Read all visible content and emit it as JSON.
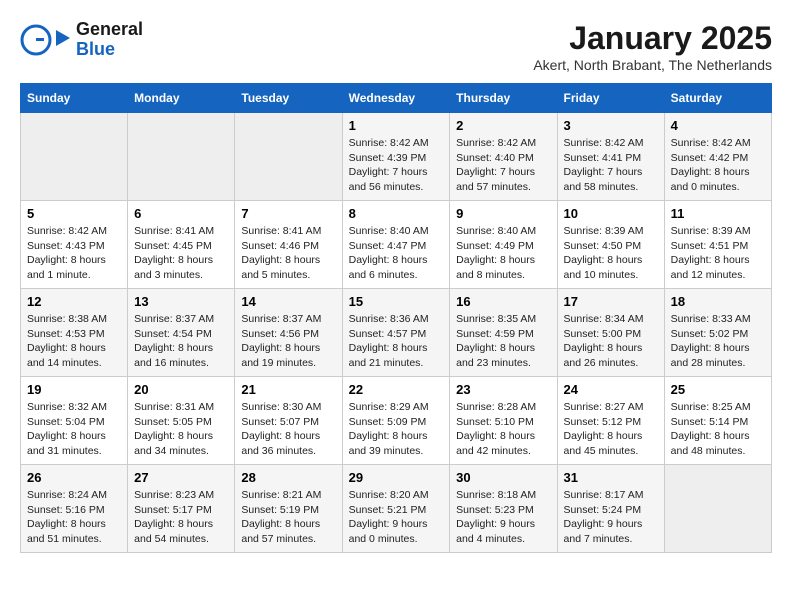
{
  "header": {
    "logo_line1": "General",
    "logo_line2": "Blue",
    "title": "January 2025",
    "subtitle": "Akert, North Brabant, The Netherlands"
  },
  "weekdays": [
    "Sunday",
    "Monday",
    "Tuesday",
    "Wednesday",
    "Thursday",
    "Friday",
    "Saturday"
  ],
  "weeks": [
    [
      {
        "day": "",
        "info": ""
      },
      {
        "day": "",
        "info": ""
      },
      {
        "day": "",
        "info": ""
      },
      {
        "day": "1",
        "info": "Sunrise: 8:42 AM\nSunset: 4:39 PM\nDaylight: 7 hours and 56 minutes."
      },
      {
        "day": "2",
        "info": "Sunrise: 8:42 AM\nSunset: 4:40 PM\nDaylight: 7 hours and 57 minutes."
      },
      {
        "day": "3",
        "info": "Sunrise: 8:42 AM\nSunset: 4:41 PM\nDaylight: 7 hours and 58 minutes."
      },
      {
        "day": "4",
        "info": "Sunrise: 8:42 AM\nSunset: 4:42 PM\nDaylight: 8 hours and 0 minutes."
      }
    ],
    [
      {
        "day": "5",
        "info": "Sunrise: 8:42 AM\nSunset: 4:43 PM\nDaylight: 8 hours and 1 minute."
      },
      {
        "day": "6",
        "info": "Sunrise: 8:41 AM\nSunset: 4:45 PM\nDaylight: 8 hours and 3 minutes."
      },
      {
        "day": "7",
        "info": "Sunrise: 8:41 AM\nSunset: 4:46 PM\nDaylight: 8 hours and 5 minutes."
      },
      {
        "day": "8",
        "info": "Sunrise: 8:40 AM\nSunset: 4:47 PM\nDaylight: 8 hours and 6 minutes."
      },
      {
        "day": "9",
        "info": "Sunrise: 8:40 AM\nSunset: 4:49 PM\nDaylight: 8 hours and 8 minutes."
      },
      {
        "day": "10",
        "info": "Sunrise: 8:39 AM\nSunset: 4:50 PM\nDaylight: 8 hours and 10 minutes."
      },
      {
        "day": "11",
        "info": "Sunrise: 8:39 AM\nSunset: 4:51 PM\nDaylight: 8 hours and 12 minutes."
      }
    ],
    [
      {
        "day": "12",
        "info": "Sunrise: 8:38 AM\nSunset: 4:53 PM\nDaylight: 8 hours and 14 minutes."
      },
      {
        "day": "13",
        "info": "Sunrise: 8:37 AM\nSunset: 4:54 PM\nDaylight: 8 hours and 16 minutes."
      },
      {
        "day": "14",
        "info": "Sunrise: 8:37 AM\nSunset: 4:56 PM\nDaylight: 8 hours and 19 minutes."
      },
      {
        "day": "15",
        "info": "Sunrise: 8:36 AM\nSunset: 4:57 PM\nDaylight: 8 hours and 21 minutes."
      },
      {
        "day": "16",
        "info": "Sunrise: 8:35 AM\nSunset: 4:59 PM\nDaylight: 8 hours and 23 minutes."
      },
      {
        "day": "17",
        "info": "Sunrise: 8:34 AM\nSunset: 5:00 PM\nDaylight: 8 hours and 26 minutes."
      },
      {
        "day": "18",
        "info": "Sunrise: 8:33 AM\nSunset: 5:02 PM\nDaylight: 8 hours and 28 minutes."
      }
    ],
    [
      {
        "day": "19",
        "info": "Sunrise: 8:32 AM\nSunset: 5:04 PM\nDaylight: 8 hours and 31 minutes."
      },
      {
        "day": "20",
        "info": "Sunrise: 8:31 AM\nSunset: 5:05 PM\nDaylight: 8 hours and 34 minutes."
      },
      {
        "day": "21",
        "info": "Sunrise: 8:30 AM\nSunset: 5:07 PM\nDaylight: 8 hours and 36 minutes."
      },
      {
        "day": "22",
        "info": "Sunrise: 8:29 AM\nSunset: 5:09 PM\nDaylight: 8 hours and 39 minutes."
      },
      {
        "day": "23",
        "info": "Sunrise: 8:28 AM\nSunset: 5:10 PM\nDaylight: 8 hours and 42 minutes."
      },
      {
        "day": "24",
        "info": "Sunrise: 8:27 AM\nSunset: 5:12 PM\nDaylight: 8 hours and 45 minutes."
      },
      {
        "day": "25",
        "info": "Sunrise: 8:25 AM\nSunset: 5:14 PM\nDaylight: 8 hours and 48 minutes."
      }
    ],
    [
      {
        "day": "26",
        "info": "Sunrise: 8:24 AM\nSunset: 5:16 PM\nDaylight: 8 hours and 51 minutes."
      },
      {
        "day": "27",
        "info": "Sunrise: 8:23 AM\nSunset: 5:17 PM\nDaylight: 8 hours and 54 minutes."
      },
      {
        "day": "28",
        "info": "Sunrise: 8:21 AM\nSunset: 5:19 PM\nDaylight: 8 hours and 57 minutes."
      },
      {
        "day": "29",
        "info": "Sunrise: 8:20 AM\nSunset: 5:21 PM\nDaylight: 9 hours and 0 minutes."
      },
      {
        "day": "30",
        "info": "Sunrise: 8:18 AM\nSunset: 5:23 PM\nDaylight: 9 hours and 4 minutes."
      },
      {
        "day": "31",
        "info": "Sunrise: 8:17 AM\nSunset: 5:24 PM\nDaylight: 9 hours and 7 minutes."
      },
      {
        "day": "",
        "info": ""
      }
    ]
  ]
}
